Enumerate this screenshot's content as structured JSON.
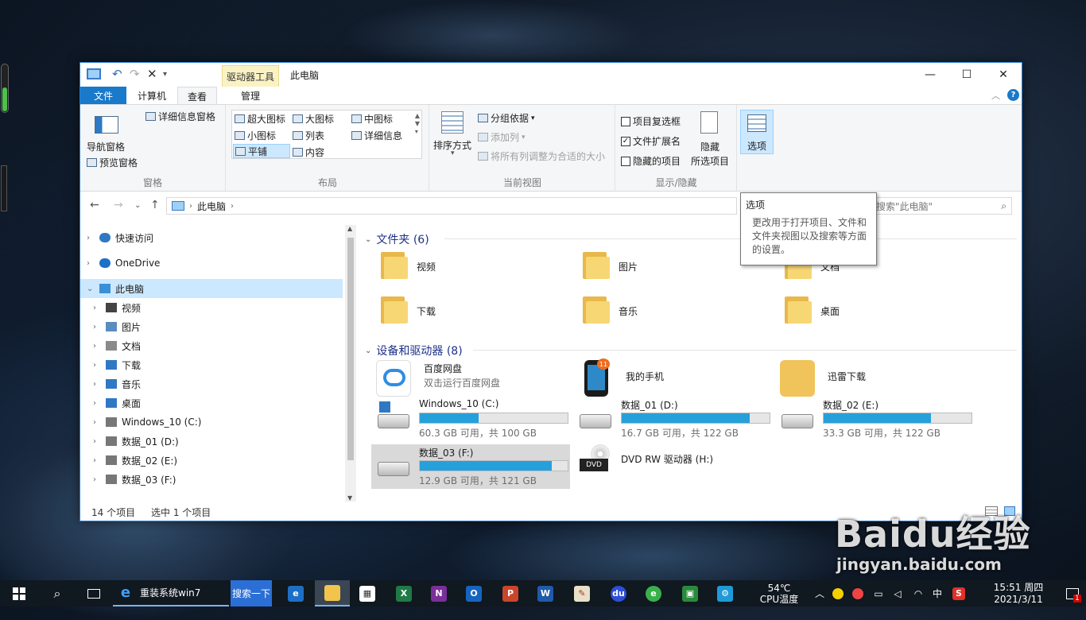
{
  "window": {
    "title": "此电脑",
    "context_tab_group": "驱动器工具",
    "controls": {
      "minimize": "—",
      "maximize": "☐",
      "close": "✕"
    }
  },
  "tabs": [
    {
      "label": "文件"
    },
    {
      "label": "计算机"
    },
    {
      "label": "查看"
    },
    {
      "label": "管理"
    }
  ],
  "ribbon": {
    "panes": {
      "label": "窗格",
      "nav_pane": "导航窗格",
      "preview_pane": "预览窗格",
      "details_pane": "详细信息窗格"
    },
    "layout": {
      "label": "布局",
      "options": [
        "超大图标",
        "大图标",
        "中图标",
        "小图标",
        "列表",
        "详细信息",
        "平铺",
        "内容"
      ],
      "selected": "平铺"
    },
    "current_view": {
      "label": "当前视图",
      "sort_by": "排序方式",
      "group_by": "分组依据",
      "add_columns": "添加列",
      "size_all_columns": "将所有列调整为合适的大小"
    },
    "show_hide": {
      "label": "显示/隐藏",
      "item_checkboxes": {
        "label": "项目复选框",
        "checked": false
      },
      "file_extensions": {
        "label": "文件扩展名",
        "checked": true
      },
      "hidden_items": {
        "label": "隐藏的项目",
        "checked": false
      },
      "hide_selected_1": "隐藏",
      "hide_selected_2": "所选项目"
    },
    "options": {
      "label": "选项"
    }
  },
  "tooltip": {
    "title": "选项",
    "body": "更改用于打开项目、文件和文件夹视图以及搜索等方面的设置。"
  },
  "address": {
    "path": "此电脑",
    "search_placeholder": "搜索\"此电脑\""
  },
  "tree": [
    {
      "label": "快速访问",
      "icon": "star-icon",
      "level": 0,
      "expanded": false
    },
    {
      "label": "OneDrive",
      "icon": "cloud-icon",
      "level": 0,
      "expanded": false
    },
    {
      "label": "此电脑",
      "icon": "computer-icon",
      "level": 0,
      "expanded": true,
      "selected": true
    },
    {
      "label": "视频",
      "icon": "video-folder-icon",
      "level": 1
    },
    {
      "label": "图片",
      "icon": "pictures-folder-icon",
      "level": 1
    },
    {
      "label": "文档",
      "icon": "documents-folder-icon",
      "level": 1
    },
    {
      "label": "下载",
      "icon": "download-icon",
      "level": 1
    },
    {
      "label": "音乐",
      "icon": "music-icon",
      "level": 1
    },
    {
      "label": "桌面",
      "icon": "desktop-icon",
      "level": 1
    },
    {
      "label": "Windows_10 (C:)",
      "icon": "system-drive-icon",
      "level": 1
    },
    {
      "label": "数据_01 (D:)",
      "icon": "drive-icon",
      "level": 1
    },
    {
      "label": "数据_02 (E:)",
      "icon": "drive-icon",
      "level": 1
    },
    {
      "label": "数据_03 (F:)",
      "icon": "drive-icon",
      "level": 1
    }
  ],
  "folders_section": {
    "title": "文件夹 (6)"
  },
  "folders": [
    {
      "label": "视频",
      "icon": "video-folder-icon"
    },
    {
      "label": "图片",
      "icon": "pictures-folder-icon"
    },
    {
      "label": "文档",
      "icon": "documents-folder-icon"
    },
    {
      "label": "下载",
      "icon": "download-folder-icon"
    },
    {
      "label": "音乐",
      "icon": "music-folder-icon"
    },
    {
      "label": "桌面",
      "icon": "desktop-folder-icon"
    }
  ],
  "devices_section": {
    "title": "设备和驱动器 (8)"
  },
  "apps": [
    {
      "label": "百度网盘",
      "sub": "双击运行百度网盘",
      "icon": "baidu-netdisk-icon"
    },
    {
      "label": "我的手机",
      "icon": "phone-icon",
      "badge": "11"
    },
    {
      "label": "迅雷下载",
      "icon": "xunlei-icon"
    }
  ],
  "drives": [
    {
      "label": "Windows_10 (C:)",
      "free": "60.3 GB 可用，共 100 GB",
      "used_fraction": 0.397
    },
    {
      "label": "数据_01 (D:)",
      "free": "16.7 GB 可用，共 122 GB",
      "used_fraction": 0.863
    },
    {
      "label": "数据_02 (E:)",
      "free": "33.3 GB 可用，共 122 GB",
      "used_fraction": 0.727
    },
    {
      "label": "数据_03 (F:)",
      "free": "12.9 GB 可用，共 121 GB",
      "used_fraction": 0.893,
      "selected": true
    }
  ],
  "dvd": {
    "label": "DVD RW 驱动器 (H:)",
    "badge": "DVD"
  },
  "status": {
    "count": "14 个项目",
    "selected": "选中 1 个项目"
  },
  "taskbar": {
    "ie_title": "重装系统win7",
    "search_button": "搜索一下",
    "temp": "54℃",
    "temp_label": "CPU温度",
    "ime": "中",
    "time": "15:51 周四",
    "date": "2021/3/11",
    "notif_count": "1"
  },
  "watermark": {
    "brand": "Baidu经验",
    "url": "jingyan.baidu.com"
  },
  "colors": {
    "accent": "#1979ca",
    "selection": "#cce8ff",
    "drive_fill": "#26a0da",
    "taskbar": "#101820"
  }
}
